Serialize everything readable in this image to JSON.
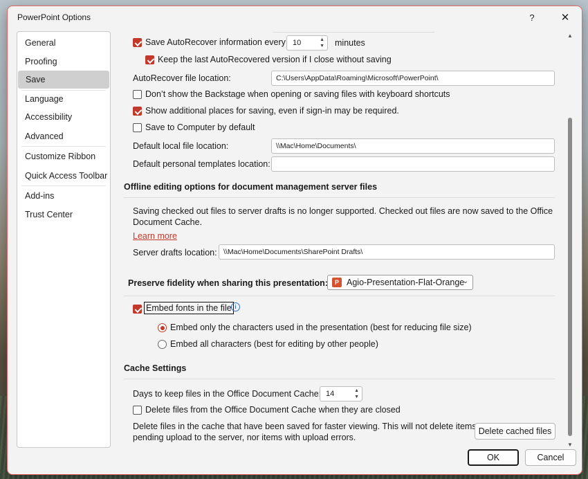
{
  "window": {
    "title": "PowerPoint Options",
    "help": "?",
    "close": "✕"
  },
  "nav": {
    "items": [
      "General",
      "Proofing",
      "Save",
      "Language",
      "Accessibility",
      "Advanced",
      "Customize Ribbon",
      "Quick Access Toolbar",
      "Add-ins",
      "Trust Center"
    ],
    "selected": "Save"
  },
  "save": {
    "autorecover_label": "Save AutoRecover information every",
    "autorecover_value": "10",
    "minutes": "minutes",
    "keep_last_label": "Keep the last AutoRecovered version if I close without saving",
    "autorecover_location_label": "AutoRecover file location:",
    "autorecover_location_value": "C:\\Users\\AppData\\Roaming\\Microsoft\\PowerPoint\\",
    "dont_show_backstage_label": "Don’t show the Backstage when opening or saving files with keyboard shortcuts",
    "show_additional_label": "Show additional places for saving, even if sign-in may be required.",
    "save_to_computer_label": "Save to Computer by default",
    "default_local_label": "Default local file location:",
    "default_local_value": "\\\\Mac\\Home\\Documents\\",
    "default_templates_label": "Default personal templates location:",
    "default_templates_value": ""
  },
  "offline": {
    "heading": "Offline editing options for document management server files",
    "notice_line1": "Saving checked out files to server drafts is no longer supported. Checked out files are now saved to the Office",
    "notice_line2": "Document Cache.",
    "learn_more": "Learn more",
    "server_drafts_label": "Server drafts location:",
    "server_drafts_value": "\\\\Mac\\Home\\Documents\\SharePoint Drafts\\"
  },
  "fidelity": {
    "heading": "Preserve fidelity when sharing this presentation:",
    "presentation": "Agio-Presentation-Flat-Orange",
    "embed_fonts_label": "Embed fonts in the file",
    "embed_only_label": "Embed only the characters used in the presentation (best for reducing file size)",
    "embed_all_label": "Embed all characters (best for editing by other people)"
  },
  "cache": {
    "heading": "Cache Settings",
    "days_label": "Days to keep files in the Office Document Cache:",
    "days_value": "14",
    "delete_closed_label": "Delete files from the Office Document Cache when they are closed",
    "delete_info_line1": "Delete files in the cache that have been saved for faster viewing. This will not delete items",
    "delete_info_line2": "pending upload to the server, nor items with upload errors.",
    "delete_button": "Delete cached files"
  },
  "footer": {
    "ok": "OK",
    "cancel": "Cancel"
  },
  "colors": {
    "accent": "#c0392b",
    "dialog_bg": "#f3f3f3",
    "border": "#e06666"
  },
  "checkbox_states": {
    "save_autorecover": true,
    "keep_last": true,
    "dont_show_backstage": false,
    "show_additional": true,
    "save_to_computer": false,
    "embed_fonts": true,
    "delete_closed": false
  },
  "radio_selected": "embed_only"
}
